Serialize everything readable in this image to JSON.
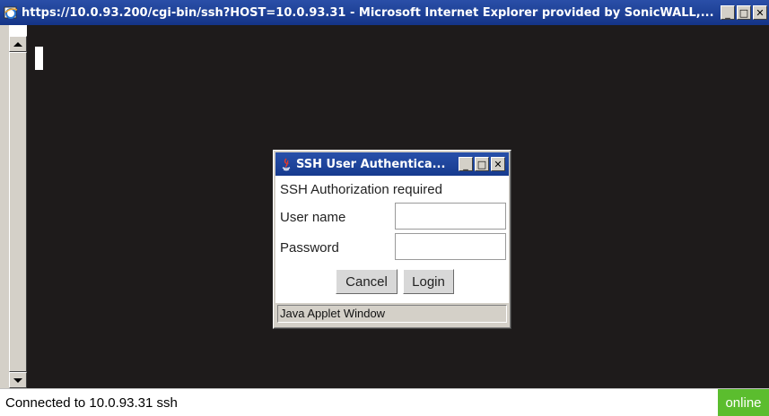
{
  "window": {
    "title": "https://10.0.93.200/cgi-bin/ssh?HOST=10.0.93.31 - Microsoft Internet Explorer provided by SonicWALL,...",
    "minimize_glyph": "_",
    "maximize_glyph": "□",
    "close_glyph": "✕",
    "icon": "ie-icon"
  },
  "status": {
    "text": "Connected to 10.0.93.31 ssh",
    "online": "online"
  },
  "dialog": {
    "title": "SSH User Authentica...",
    "icon": "java-icon",
    "message": "SSH Authorization required",
    "username_label": "User name",
    "password_label": "Password",
    "username_value": "",
    "password_value": "",
    "cancel_label": "Cancel",
    "login_label": "Login",
    "footer": "Java Applet Window"
  },
  "colors": {
    "terminal_bg": "#1e1b1b",
    "titlebar": "#1c3e96",
    "online": "#5bbd2e"
  }
}
